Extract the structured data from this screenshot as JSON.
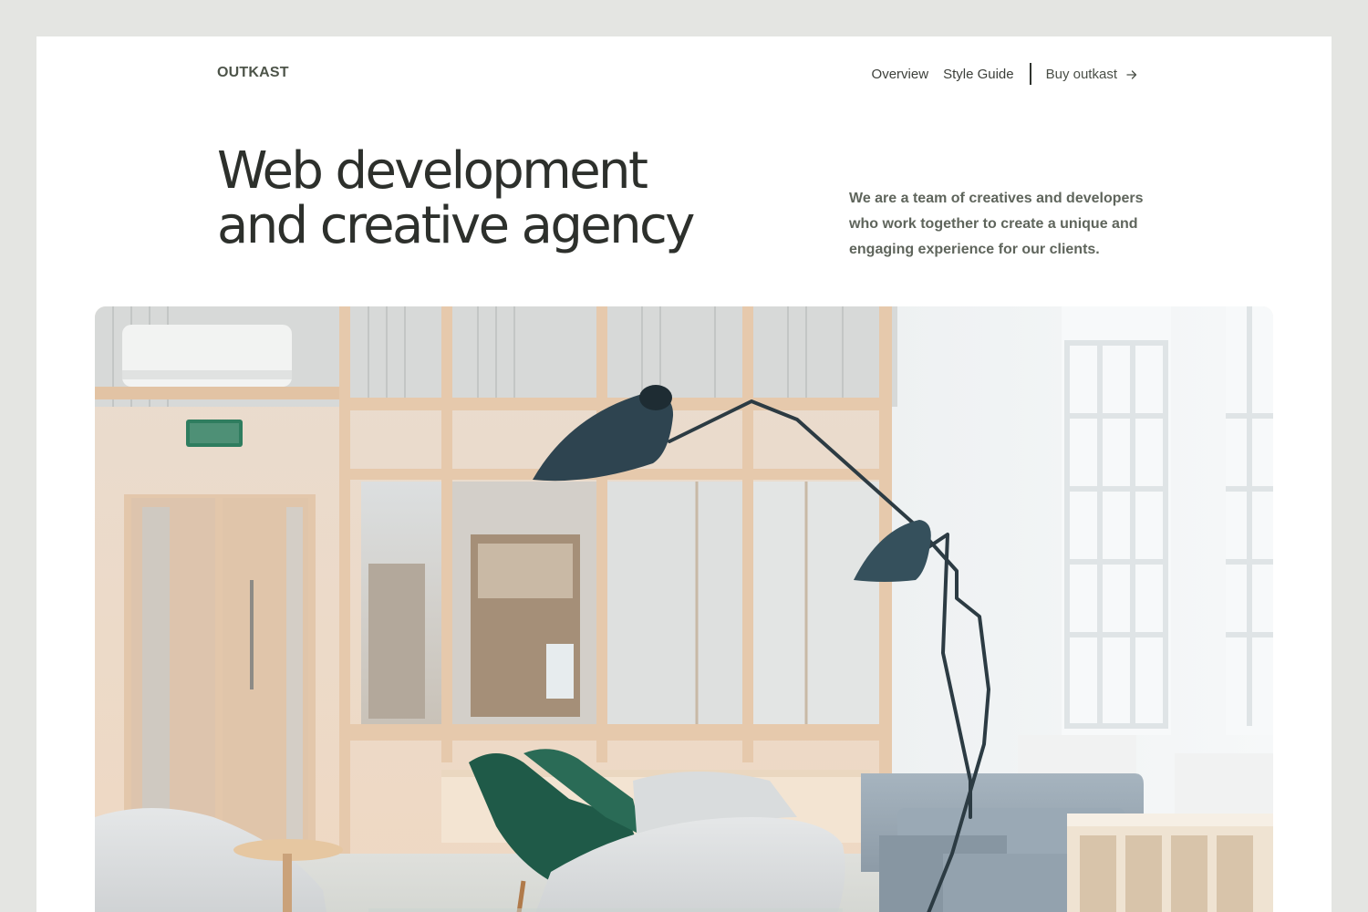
{
  "brand": {
    "logo": "OUTKAST"
  },
  "nav": {
    "items": [
      {
        "label": "Overview"
      },
      {
        "label": "Style Guide"
      }
    ],
    "cta": {
      "label": "Buy outkast",
      "icon": "arrow-right-icon"
    }
  },
  "hero": {
    "headline_line1": "Web development",
    "headline_line2": "and creative agency",
    "intro": "We are a team of creatives and developers who work together to create a unique and engaging experience for our clients."
  },
  "colors": {
    "page_background": "#e4e5e2",
    "content_background": "#ffffff",
    "heading": "#2d302c",
    "body_text": "#5f655c",
    "logo": "#4d5449"
  }
}
